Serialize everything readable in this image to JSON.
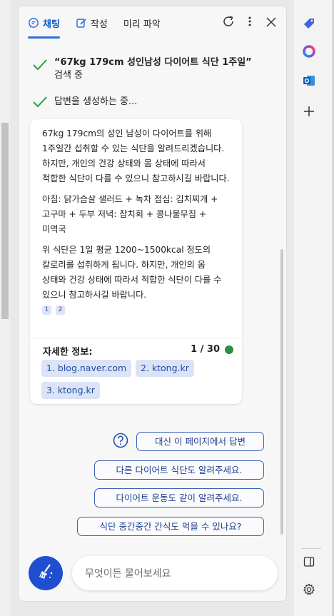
{
  "header": {
    "tabs": [
      {
        "label": "채팅",
        "icon": "chat-icon",
        "active": true
      },
      {
        "label": "작성",
        "icon": "compose-icon",
        "active": false
      },
      {
        "label": "미리 파악",
        "icon": "",
        "active": false
      }
    ],
    "buttons": [
      "refresh-icon",
      "more-icon",
      "close-icon"
    ]
  },
  "status": {
    "search_query": "“67kg 179cm 성인남성 다이어트 식단 1주일”",
    "search_suffix": "검색 중",
    "generating": "답변을 생성하는 중..."
  },
  "answer": {
    "paragraphs": [
      "67kg 179cm의 성인 남성이 다이어트를 위해 1주일간 섭취할 수 있는 식단을 알려드리겠습니다. 하지만, 개인의 건강 상태와 몸 상태에 따라서 적합한 식단이 다를 수 있으니 참고하시길 바랍니다.",
      "아침: 닭가슴살 샐러드 + 녹차 점심: 김치찌개 + 고구마 + 두부 저녁: 참치회 + 콩나물무침 + 미역국",
      "위 식단은 1일 평균 1200~1500kcal 정도의 칼로리를 섭취하게 됩니다. 하지만, 개인의 몸 상태와 건강 상태에 따라서 적합한 식단이 다를 수 있으니 참고하시길 바랍니다."
    ],
    "citations": [
      "1",
      "2"
    ],
    "more_info_title": "자세한 정보:",
    "count": "1 / 30",
    "sources": [
      "1. blog.naver.com",
      "2. ktong.kr",
      "3. ktong.kr"
    ]
  },
  "suggestions": [
    "대신 이 페이지에서 답변",
    "다른 다이어트 식단도 알려주세요.",
    "다이어트 운동도 같이 알려주세요.",
    "식단 중간중간 간식도 먹을 수 있나요?"
  ],
  "input": {
    "placeholder": "무엇이든 물어보세요"
  },
  "colors": {
    "accent": "#1f4fcf",
    "check": "#23a33d",
    "status_dot": "#2f8d3f",
    "source_bg": "#dce3f7"
  },
  "sidebar": {
    "icons": [
      "tag-icon",
      "office-icon",
      "outlook-icon",
      "add-icon",
      "split-view-icon",
      "settings-icon"
    ]
  }
}
